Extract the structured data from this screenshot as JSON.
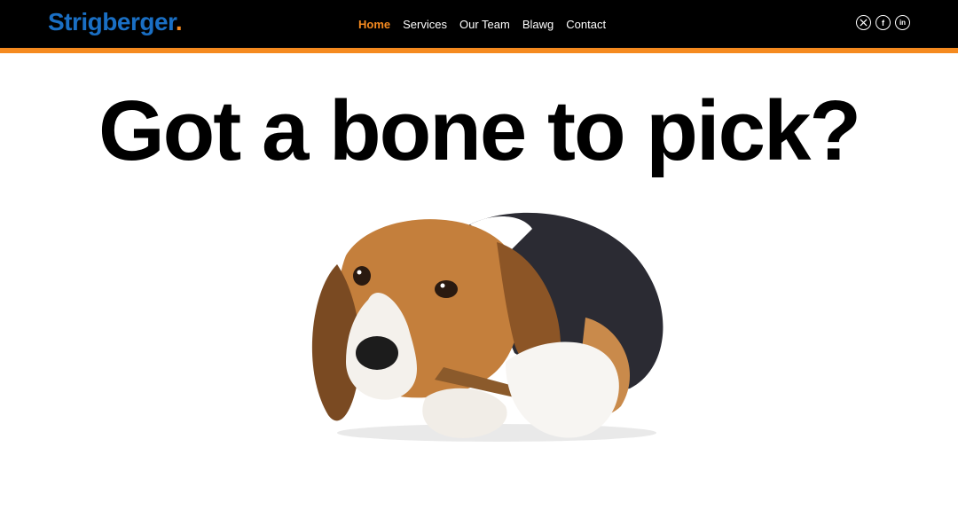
{
  "brand": {
    "name": "Strigberger",
    "dot": ".",
    "name_color": "#1a6fc4",
    "dot_color": "#f58a1f"
  },
  "nav": {
    "items": [
      {
        "label": "Home",
        "active": true
      },
      {
        "label": "Services",
        "active": false
      },
      {
        "label": "Our Team",
        "active": false
      },
      {
        "label": "Blawg",
        "active": false
      },
      {
        "label": "Contact",
        "active": false
      }
    ],
    "accent_color": "#f58a1f"
  },
  "social": [
    {
      "icon": "x-twitter-icon",
      "glyph": "𝕏"
    },
    {
      "icon": "facebook-icon",
      "glyph": "f"
    },
    {
      "icon": "linkedin-icon",
      "glyph": "in"
    }
  ],
  "hero": {
    "headline": "Got a bone to pick?",
    "image": "beagle-puppy-chewing-bone"
  }
}
